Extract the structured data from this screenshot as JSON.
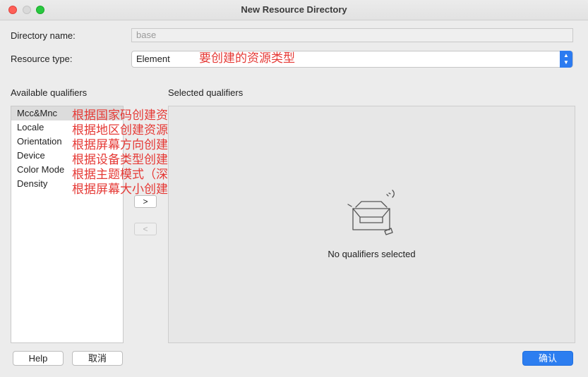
{
  "window": {
    "title": "New Resource Directory"
  },
  "form": {
    "directory_name_label": "Directory name:",
    "directory_name_value": "base",
    "resource_type_label": "Resource type:",
    "resource_type_value": "Element",
    "resource_type_annotation": "要创建的资源类型"
  },
  "qualifiers": {
    "available_label": "Available qualifiers",
    "selected_label": "Selected qualifiers",
    "items": [
      {
        "label": "Mcc&Mnc",
        "annotation": "根据国家码创建资源"
      },
      {
        "label": "Locale",
        "annotation": "根据地区创建资源"
      },
      {
        "label": "Orientation",
        "annotation": "根据屏幕方向创建资源"
      },
      {
        "label": "Device",
        "annotation": "根据设备类型创建资源"
      },
      {
        "label": "Color Mode",
        "annotation": "根据主题模式（深色、浅色）创建资源"
      },
      {
        "label": "Density",
        "annotation": "根据屏幕大小创建资源"
      }
    ],
    "add_button": ">",
    "remove_button": "<",
    "empty_text": "No qualifiers selected"
  },
  "footer": {
    "help": "Help",
    "cancel": "取消",
    "confirm": "确认"
  },
  "icons": {
    "select_arrow": "chevron-updown-icon",
    "empty_state": "empty-tray-icon"
  }
}
